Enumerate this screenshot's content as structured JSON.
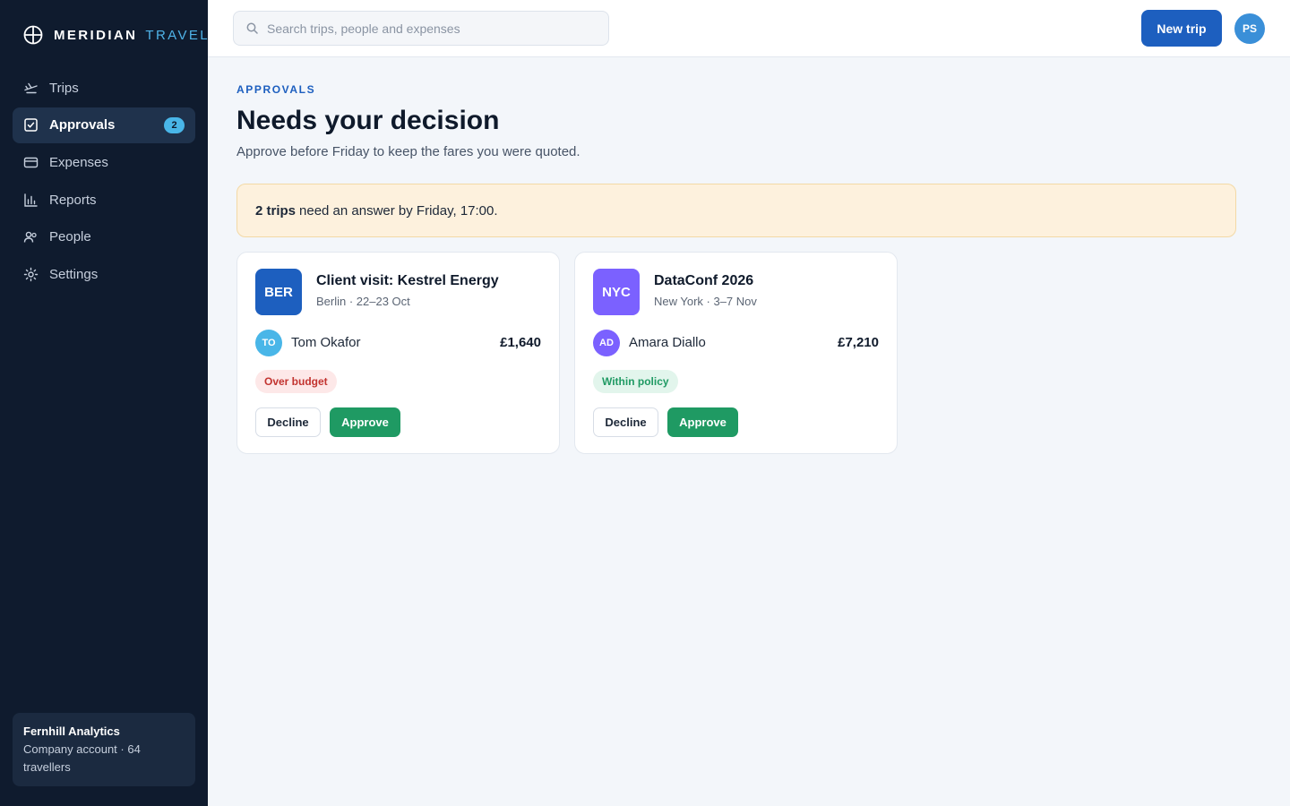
{
  "brand": {
    "name": "MERIDIAN",
    "sub": "TRAVEL",
    "icon": "globe-crosshair-icon"
  },
  "sidebar": {
    "items": [
      {
        "label": "Trips",
        "icon": "plane-icon"
      },
      {
        "label": "Approvals",
        "icon": "check-square-icon",
        "badge": "2",
        "active": true
      },
      {
        "label": "Expenses",
        "icon": "card-icon"
      },
      {
        "label": "Reports",
        "icon": "bar-chart-icon"
      },
      {
        "label": "People",
        "icon": "people-icon"
      },
      {
        "label": "Settings",
        "icon": "gear-icon"
      }
    ],
    "account": {
      "name": "Fernhill Analytics",
      "desc": "Company account · 64 travellers"
    }
  },
  "topbar": {
    "search_placeholder": "Search trips, people and expenses",
    "new_trip_label": "New trip",
    "user_initials": "PS"
  },
  "main": {
    "eyebrow": "APPROVALS",
    "title": "Needs your decision",
    "subtitle": "Approve before Friday to keep the fares you were quoted.",
    "alert": {
      "strong": "2 trips",
      "text": "need an answer by Friday, 17:00."
    },
    "cards": [
      {
        "code": "BER",
        "code_color": "#1d5fbf",
        "title": "Client visit: Kestrel Energy",
        "meta": "Berlin · 22–23 Oct",
        "person_initials": "TO",
        "person_color": "#49b6e8",
        "person_name": "Tom Okafor",
        "amount": "£1,640",
        "status": "Over budget",
        "status_bg": "#fde8e8",
        "status_fg": "#c2332f",
        "decline_label": "Decline",
        "approve_label": "Approve"
      },
      {
        "code": "NYC",
        "code_color": "#7b61ff",
        "title": "DataConf 2026",
        "meta": "New York · 3–7 Nov",
        "person_initials": "AD",
        "person_color": "#7b61ff",
        "person_name": "Amara Diallo",
        "amount": "£7,210",
        "status": "Within policy",
        "status_bg": "#e2f5ec",
        "status_fg": "#1f9a63",
        "decline_label": "Decline",
        "approve_label": "Approve"
      }
    ]
  },
  "colors": {
    "sidebar_bg": "#0f1b2e",
    "accent": "#1d5fbf",
    "approve": "#1f9a63",
    "page_bg": "#f3f6fa"
  }
}
